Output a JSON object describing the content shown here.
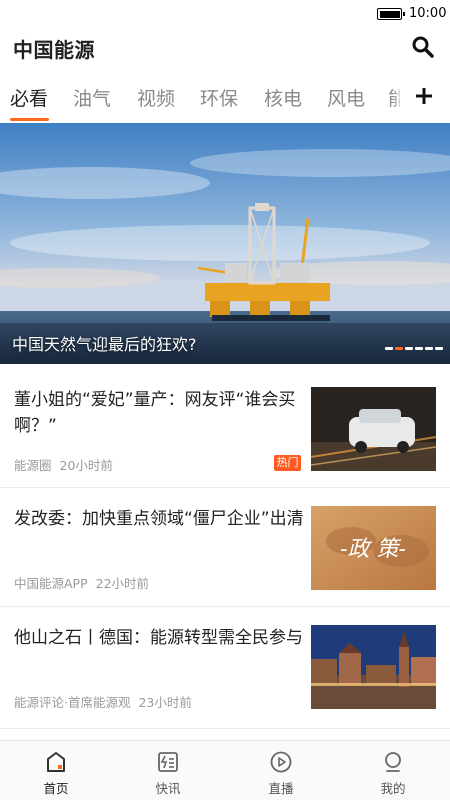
{
  "status_bar": {
    "time": "10:00"
  },
  "header": {
    "title": "中国能源",
    "search_icon": "search-icon"
  },
  "tabs": {
    "items": [
      "必看",
      "油气",
      "视频",
      "环保",
      "核电",
      "风电"
    ],
    "overflow_tab": "能",
    "active_index": 0,
    "add_icon": "plus-icon"
  },
  "banner": {
    "caption": "中国天然气迎最后的狂欢?",
    "slide_count": 6,
    "active_slide": 1
  },
  "news": [
    {
      "title": "董小姐的“爱妃”量产：网友评“谁会买啊？”",
      "source": "能源圈",
      "time": "20小时前",
      "badge": "热门",
      "thumbnail": "car-photo"
    },
    {
      "title": "发改委：加快重点领域“僵尸企业”出清",
      "source": "中国能源APP",
      "time": "22小时前",
      "thumbnail_text": "-政 策-"
    },
    {
      "title": "他山之石丨德国：能源转型需全民参与",
      "source": "能源评论·首席能源观",
      "time": "23小时前",
      "thumbnail": "city-square-photo"
    }
  ],
  "bottom_nav": [
    {
      "label": "首页",
      "icon": "home-icon",
      "active": true
    },
    {
      "label": "快讯",
      "icon": "flash-news-icon",
      "active": false
    },
    {
      "label": "直播",
      "icon": "live-play-icon",
      "active": false
    },
    {
      "label": "我的",
      "icon": "profile-icon",
      "active": false
    }
  ],
  "colors": {
    "accent": "#ff6a1a",
    "text": "#222222",
    "muted": "#9a9a9a"
  }
}
